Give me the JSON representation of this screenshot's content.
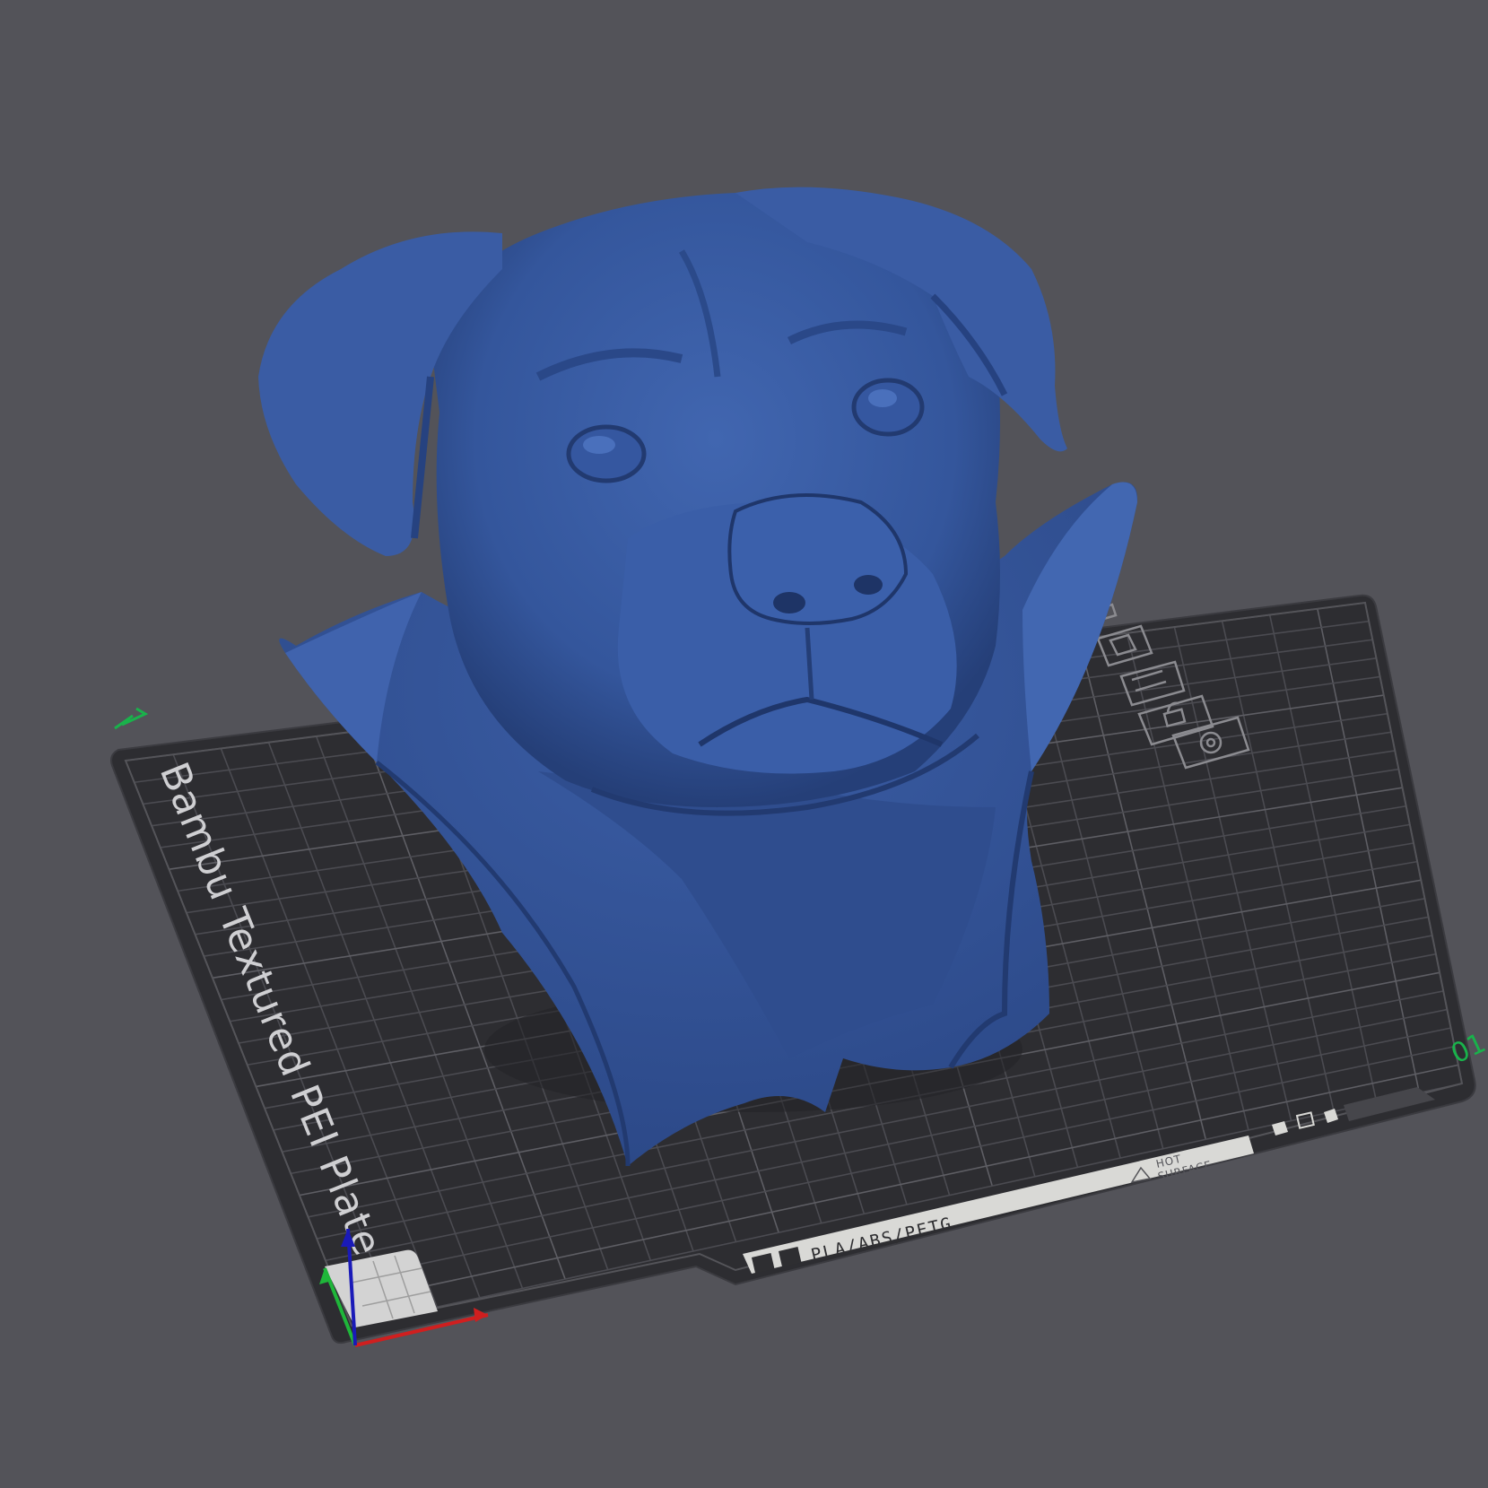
{
  "viewport": {
    "background_color": "#535359",
    "plate": {
      "name": "Bambu Textured PEI Plate",
      "material_strip": "PLA/ABS/PETG",
      "warning_line1": "HOT",
      "warning_line2": "SURFACE",
      "plate_number": "01",
      "surface_color": "#2d2d31",
      "grid_color": "#55555b"
    },
    "model": {
      "description_icon": "dog-bust-model",
      "color": "#34569c"
    },
    "axes": {
      "x_color": "#d01f1f",
      "y_color": "#1fb63a",
      "z_color": "#1a1ab8"
    },
    "plate_icons": [
      "arrange-icon",
      "orient-icon",
      "layout-icon",
      "lock-icon",
      "settings-icon"
    ]
  }
}
